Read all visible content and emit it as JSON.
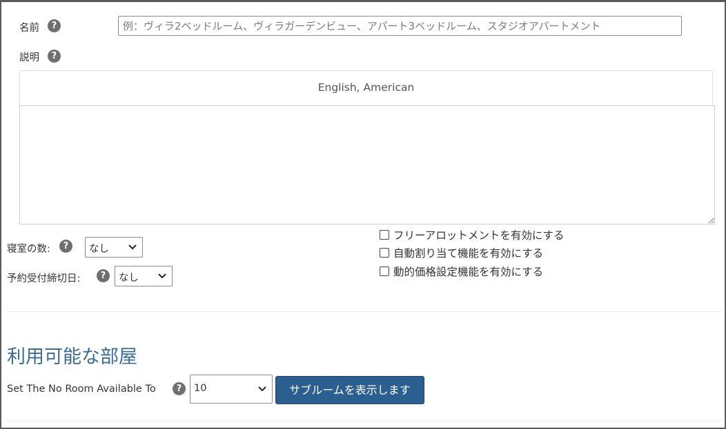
{
  "form": {
    "name_label": "名前",
    "name_placeholder": "例：ヴィラ2ベッドルーム、ヴィラガーデンビュー、アパート3ベッドルーム、スタジオアパートメント",
    "description_label": "説明",
    "language_tab": "English, American",
    "bedrooms_label": "寝室の数:",
    "bedrooms_value": "なし",
    "cutoff_label": "予約受付締切日:",
    "cutoff_value": "なし",
    "checkboxes": [
      {
        "label": "フリーアロットメントを有効にする",
        "checked": false
      },
      {
        "label": "自動割り当て機能を有効にする",
        "checked": false
      },
      {
        "label": "動的価格設定機能を有効にする",
        "checked": false
      }
    ]
  },
  "available_rooms": {
    "title": "利用可能な部屋",
    "set_label": "Set The No Room Available To",
    "set_value": "10",
    "show_subrooms_button": "サブルームを表示します"
  },
  "colors": {
    "section_title": "#3a6d99",
    "primary_button": "#2a5f8f",
    "help_icon": "#6f6f6f"
  },
  "icons": {
    "help": "question-circle-icon",
    "dropdown": "chevron-down-icon"
  }
}
